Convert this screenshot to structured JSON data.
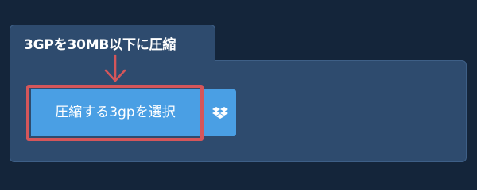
{
  "panel": {
    "tab_title": "3GPを30MB以下に圧縮"
  },
  "upload": {
    "select_button_label": "圧縮する3gpを選択",
    "dropbox_icon": "dropbox-icon"
  },
  "annotation": {
    "arrow_icon": "down-arrow-icon",
    "highlight_color": "#d5565a"
  },
  "colors": {
    "background": "#14253a",
    "panel": "#2e4b6e",
    "button": "#4a9fe4",
    "text": "#ffffff"
  }
}
